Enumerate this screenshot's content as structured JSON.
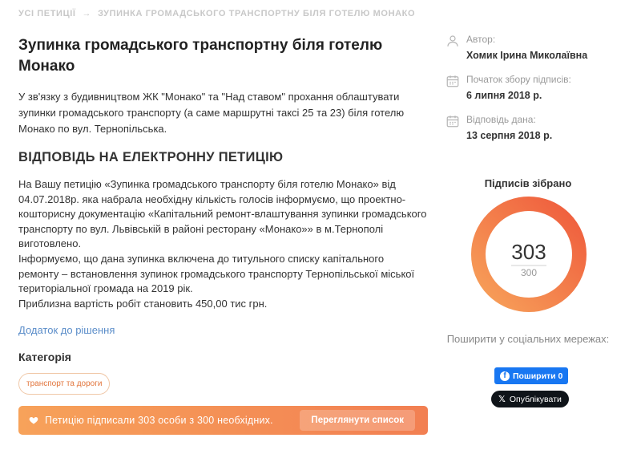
{
  "breadcrumb": {
    "all_petitions": "УСІ ПЕТИЦІЇ",
    "separator": "→",
    "current": "ЗУПИНКА ГРОМАДСЬКОГО ТРАНСПОРТНУ БІЛЯ ГОТЕЛЮ МОНАКО"
  },
  "petition": {
    "title": "Зупинка громадського транспортну біля готелю Монако",
    "description": "У зв'язку з будивництвом ЖК \"Монако\" та \"Над ставом\" прохання облаштувати зупинки громадського транспорту (а саме маршрутні таксі 25 та 23) біля готелю Монако по вул. Тернопільська.",
    "answer_heading": "ВІДПОВІДЬ НА ЕЛЕКТРОННУ ПЕТИЦІЮ",
    "answer_lines": [
      "На Вашу петицію «Зупинка громадського транспорту біля готелю Монако» від 04.07.2018р. яка набрала необхідну кількість голосів інформуємо, що проектно-кошторисну документацію «Капітальний ремонт-влаштування зупинки громадського транспорту по вул. Львівській в районі ресторану «Монако»» в м.Тернополі виготовлено.",
      "Інформуємо, що дана зупинка включена до титульного списку капітального ремонту – встановлення зупинок громадського транспорту Тернопільської міської територіальної громада на 2019 рік.",
      "Приблизна вартість робіт становить 450,00 тис грн."
    ],
    "addition_link": "Додаток до рішення",
    "category_heading": "Категорія",
    "category_tag": "транспорт та дороги"
  },
  "banner": {
    "text": "Петицію підписали 303 особи з 300 необхідних.",
    "button": "Переглянути список",
    "icon": "heart-icon"
  },
  "sidebar": {
    "author_label": "Автор:",
    "author_value": "Хомик Ірина Миколаївна",
    "start_label": "Початок збору підписів:",
    "start_value": "6 липня 2018 р.",
    "answer_label": "Відповідь дана:",
    "answer_value": "13 серпня 2018 р.",
    "signatures_title": "Підписів зібрано",
    "signatures_collected": "303",
    "signatures_required": "300",
    "progress_fraction": 1.0,
    "share_text": "Поширити у соціальних мережах:",
    "facebook_button": "Поширити 0",
    "x_button": "Опублікувати"
  },
  "colors": {
    "accent": "#f27f52",
    "ring_start": "#f7a25a",
    "ring_end": "#ef5a3c",
    "link": "#5b8dc9",
    "facebook": "#1877f2"
  }
}
